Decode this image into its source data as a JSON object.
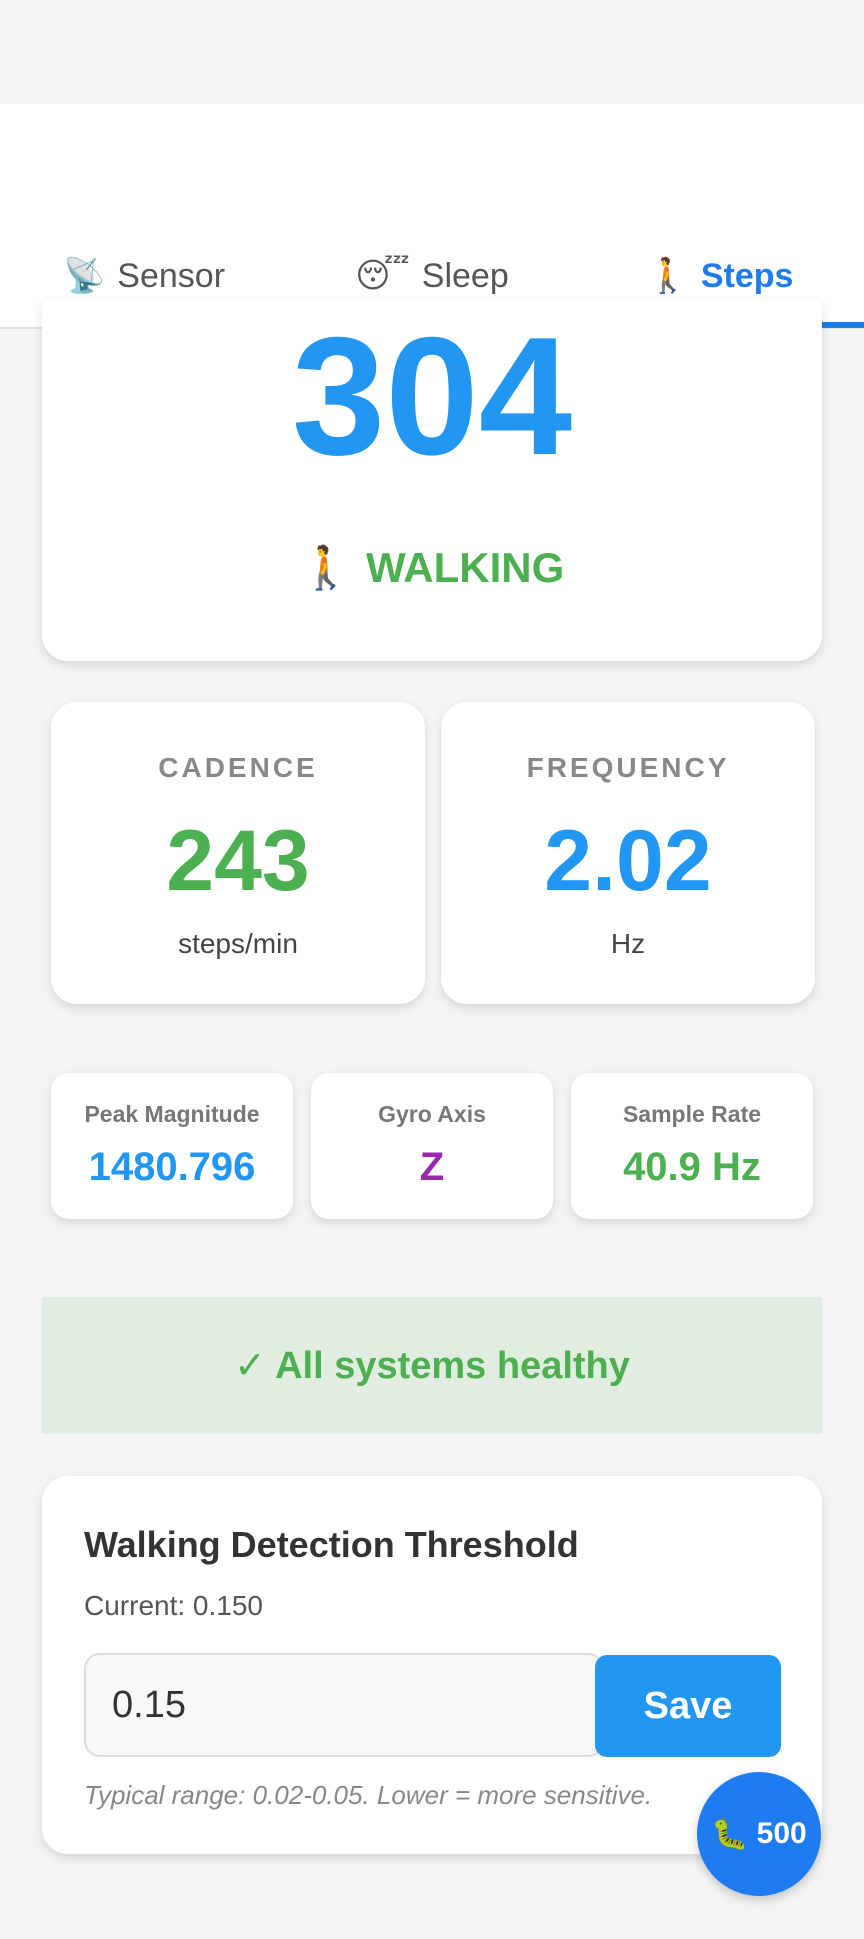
{
  "tabs": [
    {
      "icon": "📡",
      "label": "Sensor",
      "active": false
    },
    {
      "icon": "😴",
      "label": "Sleep",
      "active": false
    },
    {
      "icon": "🚶",
      "label": "Steps",
      "active": true
    }
  ],
  "hero": {
    "count": "304",
    "state_icon": "🚶",
    "state": "WALKING"
  },
  "metrics": [
    {
      "label": "CADENCE",
      "value": "243",
      "unit": "steps/min",
      "color": "#4caf50"
    },
    {
      "label": "FREQUENCY",
      "value": "2.02",
      "unit": "Hz",
      "color": "#2196f3"
    }
  ],
  "minis": [
    {
      "label": "Peak Magnitude",
      "value": "1480.796",
      "color": "#2196f3"
    },
    {
      "label": "Gyro Axis",
      "value": "Z",
      "color": "#9c27b0"
    },
    {
      "label": "Sample Rate",
      "value": "40.9 Hz",
      "color": "#4caf50"
    }
  ],
  "health": {
    "text": "✓ All systems healthy"
  },
  "threshold": {
    "title": "Walking Detection Threshold",
    "current": "Current: 0.150",
    "input_value": "0.15",
    "save_label": "Save",
    "hint": "Typical range: 0.02-0.05. Lower = more sensitive."
  },
  "fab": {
    "icon": "🐛",
    "label": "500"
  }
}
